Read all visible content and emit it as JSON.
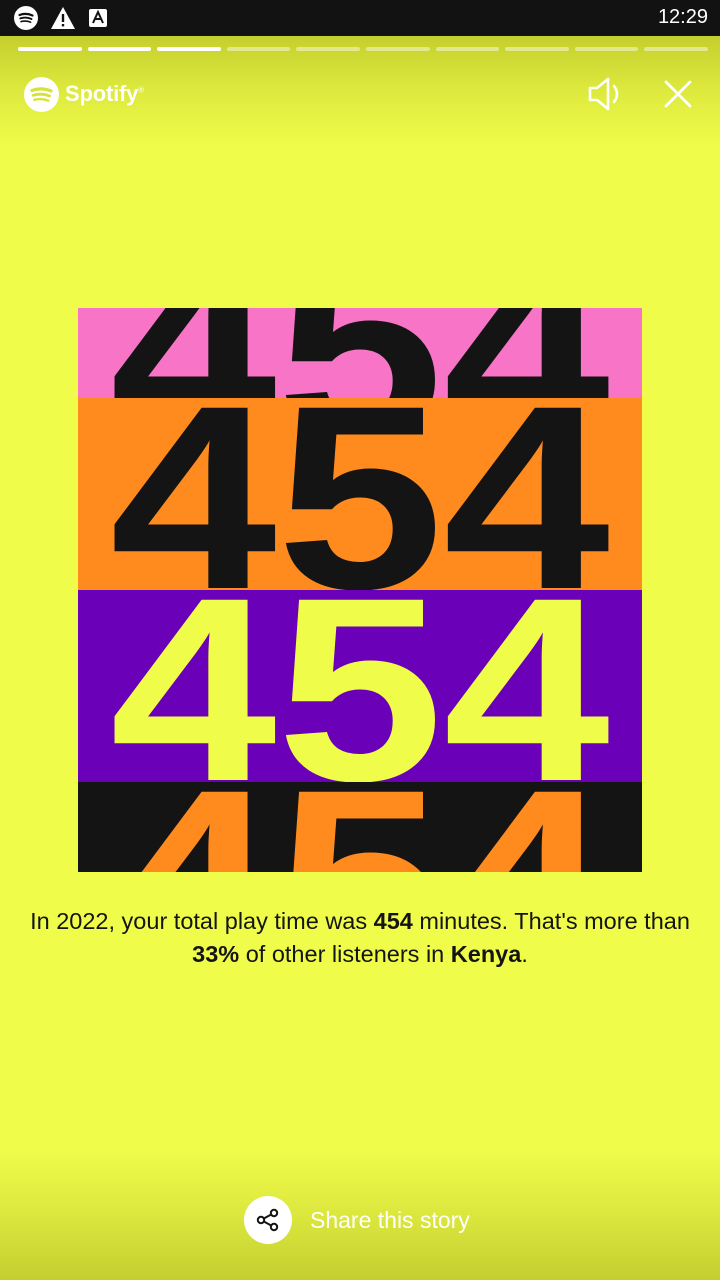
{
  "status_bar": {
    "time": "12:29",
    "icons": [
      "spotify-icon",
      "warning-icon",
      "font-app-icon"
    ]
  },
  "story": {
    "segments_total": 10,
    "segments_completed": 3
  },
  "header": {
    "brand": "Spotify",
    "brand_mark": "®"
  },
  "art": {
    "number": "454",
    "bands": [
      {
        "bg": "#F774C6",
        "fg": "#141414"
      },
      {
        "bg": "#FF8A1E",
        "fg": "#141414"
      },
      {
        "bg": "#6A00B8",
        "fg": "#F0FC4A"
      },
      {
        "bg": "#141414",
        "fg": "#FF8A1E"
      }
    ]
  },
  "caption": {
    "part1": "In 2022, your total play time was ",
    "minutes": "454",
    "part2": " minutes. That's more than ",
    "percent": "33%",
    "part3": " of other listeners in ",
    "country": "Kenya",
    "part4": "."
  },
  "share": {
    "label": "Share this story"
  },
  "colors": {
    "background": "#F0FC4A",
    "text": "#141414"
  }
}
